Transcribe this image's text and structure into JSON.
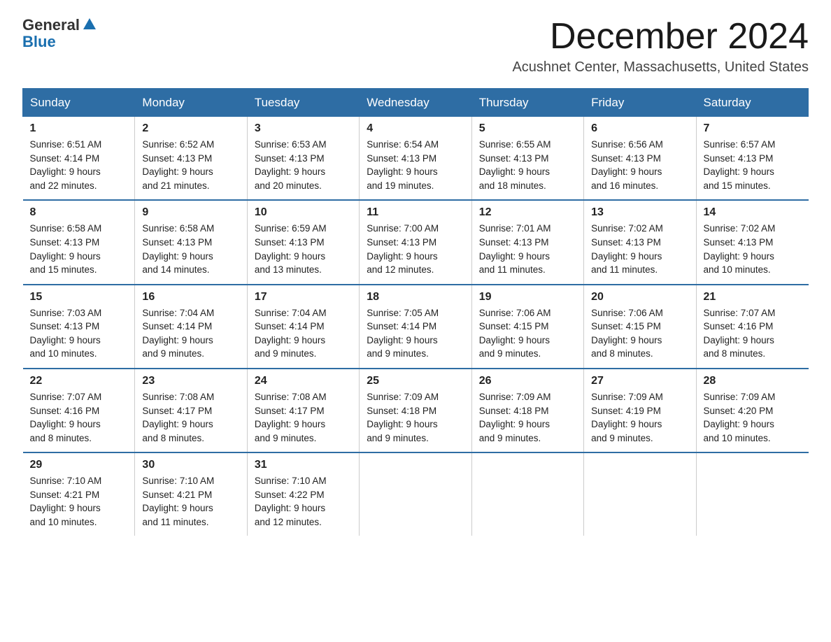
{
  "header": {
    "logo_general": "General",
    "logo_blue": "Blue",
    "month": "December 2024",
    "location": "Acushnet Center, Massachusetts, United States"
  },
  "weekdays": [
    "Sunday",
    "Monday",
    "Tuesday",
    "Wednesday",
    "Thursday",
    "Friday",
    "Saturday"
  ],
  "weeks": [
    [
      {
        "day": "1",
        "info": "Sunrise: 6:51 AM\nSunset: 4:14 PM\nDaylight: 9 hours\nand 22 minutes."
      },
      {
        "day": "2",
        "info": "Sunrise: 6:52 AM\nSunset: 4:13 PM\nDaylight: 9 hours\nand 21 minutes."
      },
      {
        "day": "3",
        "info": "Sunrise: 6:53 AM\nSunset: 4:13 PM\nDaylight: 9 hours\nand 20 minutes."
      },
      {
        "day": "4",
        "info": "Sunrise: 6:54 AM\nSunset: 4:13 PM\nDaylight: 9 hours\nand 19 minutes."
      },
      {
        "day": "5",
        "info": "Sunrise: 6:55 AM\nSunset: 4:13 PM\nDaylight: 9 hours\nand 18 minutes."
      },
      {
        "day": "6",
        "info": "Sunrise: 6:56 AM\nSunset: 4:13 PM\nDaylight: 9 hours\nand 16 minutes."
      },
      {
        "day": "7",
        "info": "Sunrise: 6:57 AM\nSunset: 4:13 PM\nDaylight: 9 hours\nand 15 minutes."
      }
    ],
    [
      {
        "day": "8",
        "info": "Sunrise: 6:58 AM\nSunset: 4:13 PM\nDaylight: 9 hours\nand 15 minutes."
      },
      {
        "day": "9",
        "info": "Sunrise: 6:58 AM\nSunset: 4:13 PM\nDaylight: 9 hours\nand 14 minutes."
      },
      {
        "day": "10",
        "info": "Sunrise: 6:59 AM\nSunset: 4:13 PM\nDaylight: 9 hours\nand 13 minutes."
      },
      {
        "day": "11",
        "info": "Sunrise: 7:00 AM\nSunset: 4:13 PM\nDaylight: 9 hours\nand 12 minutes."
      },
      {
        "day": "12",
        "info": "Sunrise: 7:01 AM\nSunset: 4:13 PM\nDaylight: 9 hours\nand 11 minutes."
      },
      {
        "day": "13",
        "info": "Sunrise: 7:02 AM\nSunset: 4:13 PM\nDaylight: 9 hours\nand 11 minutes."
      },
      {
        "day": "14",
        "info": "Sunrise: 7:02 AM\nSunset: 4:13 PM\nDaylight: 9 hours\nand 10 minutes."
      }
    ],
    [
      {
        "day": "15",
        "info": "Sunrise: 7:03 AM\nSunset: 4:13 PM\nDaylight: 9 hours\nand 10 minutes."
      },
      {
        "day": "16",
        "info": "Sunrise: 7:04 AM\nSunset: 4:14 PM\nDaylight: 9 hours\nand 9 minutes."
      },
      {
        "day": "17",
        "info": "Sunrise: 7:04 AM\nSunset: 4:14 PM\nDaylight: 9 hours\nand 9 minutes."
      },
      {
        "day": "18",
        "info": "Sunrise: 7:05 AM\nSunset: 4:14 PM\nDaylight: 9 hours\nand 9 minutes."
      },
      {
        "day": "19",
        "info": "Sunrise: 7:06 AM\nSunset: 4:15 PM\nDaylight: 9 hours\nand 9 minutes."
      },
      {
        "day": "20",
        "info": "Sunrise: 7:06 AM\nSunset: 4:15 PM\nDaylight: 9 hours\nand 8 minutes."
      },
      {
        "day": "21",
        "info": "Sunrise: 7:07 AM\nSunset: 4:16 PM\nDaylight: 9 hours\nand 8 minutes."
      }
    ],
    [
      {
        "day": "22",
        "info": "Sunrise: 7:07 AM\nSunset: 4:16 PM\nDaylight: 9 hours\nand 8 minutes."
      },
      {
        "day": "23",
        "info": "Sunrise: 7:08 AM\nSunset: 4:17 PM\nDaylight: 9 hours\nand 8 minutes."
      },
      {
        "day": "24",
        "info": "Sunrise: 7:08 AM\nSunset: 4:17 PM\nDaylight: 9 hours\nand 9 minutes."
      },
      {
        "day": "25",
        "info": "Sunrise: 7:09 AM\nSunset: 4:18 PM\nDaylight: 9 hours\nand 9 minutes."
      },
      {
        "day": "26",
        "info": "Sunrise: 7:09 AM\nSunset: 4:18 PM\nDaylight: 9 hours\nand 9 minutes."
      },
      {
        "day": "27",
        "info": "Sunrise: 7:09 AM\nSunset: 4:19 PM\nDaylight: 9 hours\nand 9 minutes."
      },
      {
        "day": "28",
        "info": "Sunrise: 7:09 AM\nSunset: 4:20 PM\nDaylight: 9 hours\nand 10 minutes."
      }
    ],
    [
      {
        "day": "29",
        "info": "Sunrise: 7:10 AM\nSunset: 4:21 PM\nDaylight: 9 hours\nand 10 minutes."
      },
      {
        "day": "30",
        "info": "Sunrise: 7:10 AM\nSunset: 4:21 PM\nDaylight: 9 hours\nand 11 minutes."
      },
      {
        "day": "31",
        "info": "Sunrise: 7:10 AM\nSunset: 4:22 PM\nDaylight: 9 hours\nand 12 minutes."
      },
      {
        "day": "",
        "info": ""
      },
      {
        "day": "",
        "info": ""
      },
      {
        "day": "",
        "info": ""
      },
      {
        "day": "",
        "info": ""
      }
    ]
  ]
}
